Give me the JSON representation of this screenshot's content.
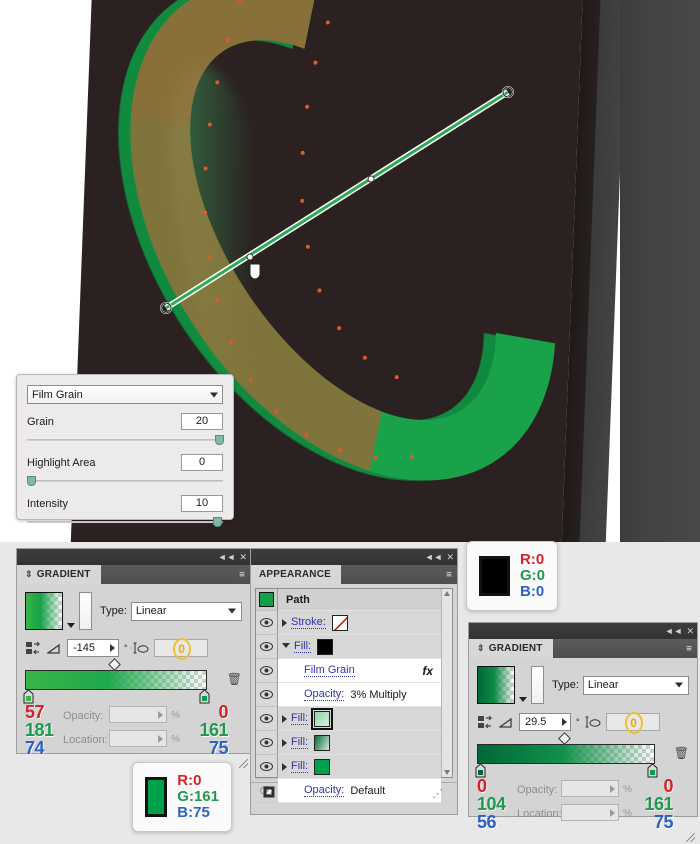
{
  "canvas": {
    "artwork_description": "letter-c-extruded-green",
    "colors": {
      "letter_green": "#19a24a",
      "letter_green_shade": "#0f8a3e",
      "card_dark": "#2b2120",
      "wall_grey": "#434343",
      "path_outline": "#e6462d"
    },
    "annotator": {
      "label": "gradient-annotator",
      "start": "160,308",
      "end": "508,88"
    }
  },
  "film_grain_dialog": {
    "effect_name": "Film Grain",
    "sliders": [
      {
        "label": "Grain",
        "accesskey": "G",
        "value": "20",
        "knob_pct": 98
      },
      {
        "label": "Highlight Area",
        "accesskey": "H",
        "value": "0",
        "knob_pct": 1
      },
      {
        "label": "Intensity",
        "accesskey": "I",
        "value": "10",
        "knob_pct": 97
      }
    ]
  },
  "gradient_panel_left": {
    "title": "GRADIENT",
    "type_label": "Type:",
    "type_value": "Linear",
    "angle_value": "-145",
    "degree_symbol": "°",
    "aspect_ratio_value": "0",
    "opacity_label": "Opacity:",
    "opacity_value": "",
    "location_label": "Location:",
    "location_value": "",
    "percent_symbol": "%",
    "stop_left": {
      "r": "57",
      "g": "181",
      "b": "74",
      "hex": "#39b54a"
    },
    "stop_right": {
      "r": "0",
      "g": "161",
      "b": "75",
      "hex": "#00a14b"
    },
    "close_glyph": "✕",
    "collapse_glyph": "◄◄",
    "menu_glyph": "≡"
  },
  "gradient_panel_right": {
    "title": "GRADIENT",
    "type_label": "Type:",
    "type_value": "Linear",
    "angle_value": "29.5",
    "degree_symbol": "°",
    "aspect_ratio_value": "0",
    "opacity_label": "Opacity:",
    "opacity_value": "",
    "location_label": "Location:",
    "location_value": "",
    "percent_symbol": "%",
    "stop_left": {
      "r": "0",
      "g": "104",
      "b": "56",
      "hex": "#006838"
    },
    "stop_right": {
      "r": "0",
      "g": "161",
      "b": "75",
      "hex": "#00a14b"
    },
    "close_glyph": "✕",
    "collapse_glyph": "◄◄",
    "menu_glyph": "≡"
  },
  "appearance_panel": {
    "title": "APPEARANCE",
    "close_glyph": "✕",
    "collapse_glyph": "◄◄",
    "menu_glyph": "≡",
    "thumbnail_color": "#13a04a",
    "rows": [
      {
        "id": "header",
        "label": "Path",
        "kind": "header",
        "eye": false
      },
      {
        "id": "stroke",
        "label": "Stroke:",
        "kind": "stroke",
        "eye": true,
        "swatch": "none",
        "disclosure": "closed"
      },
      {
        "id": "fill0",
        "label": "Fill:",
        "kind": "fill",
        "eye": true,
        "swatch": "#000000",
        "disclosure": "open"
      },
      {
        "id": "effect",
        "label": "Film Grain",
        "kind": "effect",
        "eye": true,
        "fx": "fx"
      },
      {
        "id": "opacity1",
        "label": "Opacity:",
        "kind": "opacity",
        "eye": true,
        "value": "3% Multiply"
      },
      {
        "id": "fill1",
        "label": "Fill:",
        "kind": "fill",
        "eye": true,
        "swatch": "gradient-light",
        "disclosure": "closed",
        "selected": true
      },
      {
        "id": "fill2",
        "label": "Fill:",
        "kind": "fill",
        "eye": true,
        "swatch": "gradient-dark",
        "disclosure": "closed"
      },
      {
        "id": "fill3",
        "label": "Fill:",
        "kind": "fill",
        "eye": true,
        "swatch": "#00a14b",
        "disclosure": "closed"
      },
      {
        "id": "opacity2",
        "label": "Opacity:",
        "kind": "opacity",
        "eye": false,
        "value": "Default"
      }
    ],
    "footer_icons": [
      "new-art-has-basic-appearance",
      "duplicate-item",
      "add-new-effect",
      "clear-appearance",
      "add-new-fill",
      "delete-item"
    ],
    "eye_glyph": "👁"
  },
  "callout_black": {
    "swatch_color": "#000000",
    "r_label": "R:",
    "r_value": "0",
    "g_label": "G:",
    "g_value": "0",
    "b_label": "B:",
    "b_value": "0"
  },
  "callout_green": {
    "swatch_color": "#00a14b",
    "r_label": "R:",
    "r_value": "0",
    "g_label": "G:",
    "g_value": "161",
    "b_label": "B:",
    "b_value": "75"
  }
}
